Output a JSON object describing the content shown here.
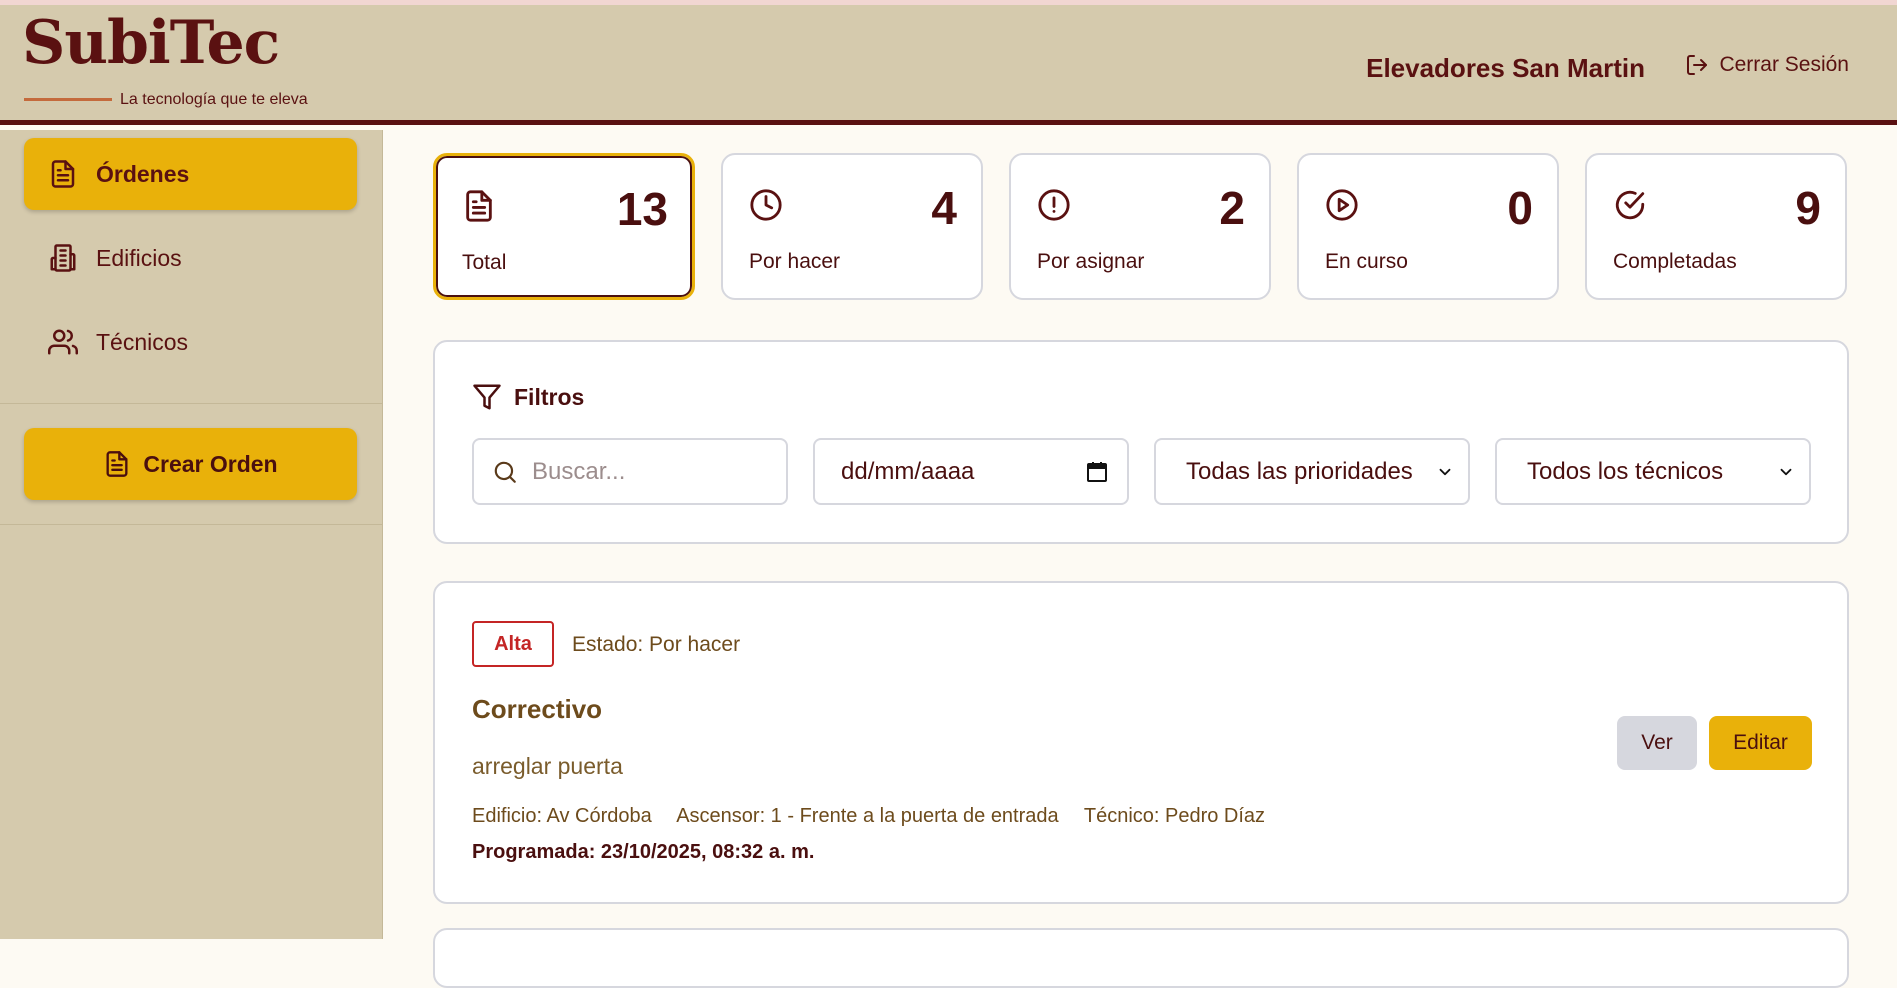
{
  "brand": {
    "name": "SubiTec",
    "tagline": "La tecnología que te eleva"
  },
  "header": {
    "company": "Elevadores San Martin",
    "logout_label": "Cerrar Sesión"
  },
  "sidebar": {
    "items": [
      {
        "label": "Órdenes",
        "icon": "document-icon",
        "active": true
      },
      {
        "label": "Edificios",
        "icon": "building-icon",
        "active": false
      },
      {
        "label": "Técnicos",
        "icon": "users-icon",
        "active": false
      }
    ],
    "create_label": "Crear Orden"
  },
  "stats": [
    {
      "label": "Total",
      "value": "13",
      "icon": "document-icon",
      "active": true
    },
    {
      "label": "Por hacer",
      "value": "4",
      "icon": "clock-icon"
    },
    {
      "label": "Por asignar",
      "value": "2",
      "icon": "alert-circle-icon"
    },
    {
      "label": "En curso",
      "value": "0",
      "icon": "play-circle-icon"
    },
    {
      "label": "Completadas",
      "value": "9",
      "icon": "check-circle-icon"
    }
  ],
  "filters": {
    "title": "Filtros",
    "search_placeholder": "Buscar...",
    "date_placeholder": "dd/mm/aaaa",
    "priority_selected": "Todas las prioridades",
    "technician_selected": "Todos los técnicos"
  },
  "orders": [
    {
      "priority": "Alta",
      "status": "Estado: Por hacer",
      "title": "Correctivo",
      "description": "arreglar puerta",
      "building": "Edificio: Av Córdoba",
      "elevator": "Ascensor: 1 - Frente a la puerta de entrada",
      "technician": "Técnico: Pedro Díaz",
      "scheduled": "Programada: 23/10/2025, 08:32 a. m.",
      "view_label": "Ver",
      "edit_label": "Editar"
    }
  ],
  "colors": {
    "brand": "#5a1111",
    "accent": "#e9b10a",
    "sidebar_bg": "#d5caad",
    "priority_high": "#c42525"
  }
}
